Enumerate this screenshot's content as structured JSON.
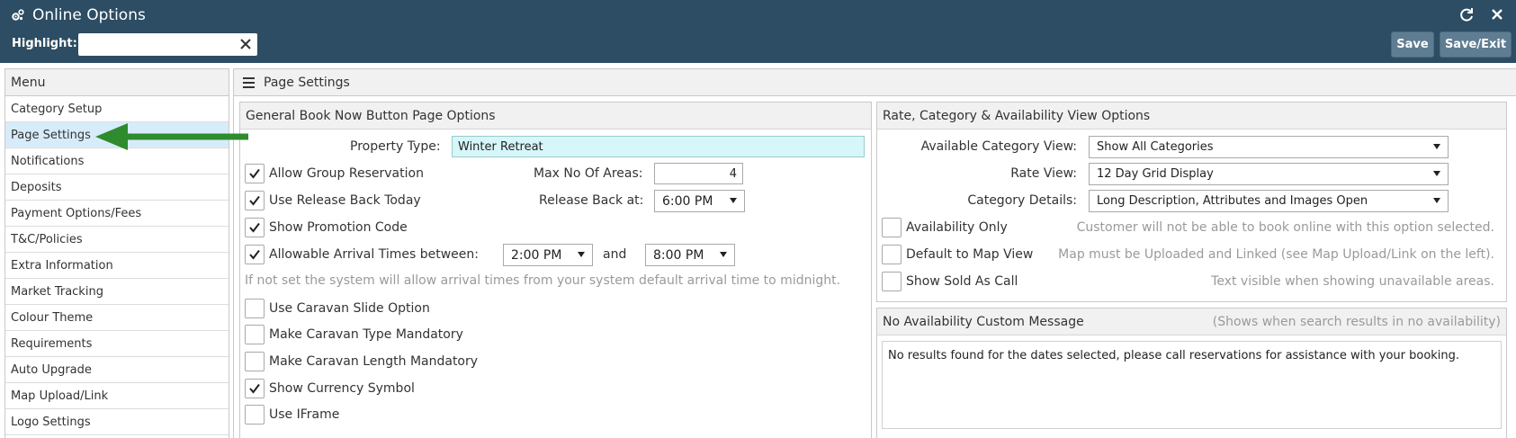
{
  "header": {
    "title": "Online Options",
    "icon": "gears-icon",
    "highlight_label": "Highlight:",
    "highlight_value": "",
    "save_label": "Save",
    "save_exit_label": "Save/Exit"
  },
  "sidebar": {
    "heading": "Menu",
    "items": [
      {
        "label": "Category Setup"
      },
      {
        "label": "Page Settings",
        "active": true
      },
      {
        "label": "Notifications"
      },
      {
        "label": "Deposits"
      },
      {
        "label": "Payment Options/Fees"
      },
      {
        "label": "T&C/Policies"
      },
      {
        "label": "Extra Information"
      },
      {
        "label": "Market Tracking"
      },
      {
        "label": "Colour Theme"
      },
      {
        "label": "Requirements"
      },
      {
        "label": "Auto Upgrade"
      },
      {
        "label": "Map Upload/Link"
      },
      {
        "label": "Logo Settings"
      }
    ]
  },
  "main": {
    "heading": "Page Settings"
  },
  "general": {
    "heading": "General Book Now Button Page Options",
    "property_type_label": "Property Type:",
    "property_type_value": "Winter Retreat",
    "allow_group": {
      "label": "Allow Group Reservation",
      "checked": true
    },
    "max_areas_label": "Max No Of Areas:",
    "max_areas_value": "4",
    "release_today": {
      "label": "Use Release Back Today",
      "checked": true
    },
    "release_back_label": "Release Back at:",
    "release_back_value": "6:00 PM",
    "promo_code": {
      "label": "Show Promotion Code",
      "checked": true
    },
    "arrival_times": {
      "label": "Allowable Arrival Times between:",
      "checked": true
    },
    "arrival_from": "2:00 PM",
    "and_label": "and",
    "arrival_to": "8:00 PM",
    "arrival_hint": "If not set the system will allow arrival times from your system default arrival time to midnight.",
    "caravan_slide": {
      "label": "Use Caravan Slide Option",
      "checked": false
    },
    "caravan_type": {
      "label": "Make Caravan Type Mandatory",
      "checked": false
    },
    "caravan_length": {
      "label": "Make Caravan Length Mandatory",
      "checked": false
    },
    "currency_symbol": {
      "label": "Show Currency Symbol",
      "checked": true
    },
    "iframe": {
      "label": "Use IFrame",
      "checked": false
    }
  },
  "rate": {
    "heading": "Rate, Category & Availability View Options",
    "category_view_label": "Available Category View:",
    "category_view_value": "Show All Categories",
    "rate_view_label": "Rate View:",
    "rate_view_value": "12 Day Grid Display",
    "category_details_label": "Category Details:",
    "category_details_value": "Long Description, Attributes and Images Open",
    "availability_only": {
      "label": "Availability Only",
      "checked": false,
      "hint": "Customer will not be able to book online with this option selected."
    },
    "map_view": {
      "label": "Default to Map View",
      "checked": false,
      "hint": "Map must be Uploaded and Linked (see Map Upload/Link on the left)."
    },
    "sold_as_call": {
      "label": "Show Sold As Call",
      "checked": false,
      "hint": "Text visible when showing unavailable areas."
    }
  },
  "no_avail": {
    "heading": "No Availability Custom Message",
    "subheading": "(Shows when search results in no availability)",
    "message": "No results found for the dates selected, please call reservations for assistance with your booking."
  },
  "colors": {
    "header_bg": "#2c4d63",
    "button_bg": "#5e7d92",
    "active_menu_bg": "#d7ecfa",
    "arrow_green": "#2e8b2e",
    "teal_field": "#d6f6f9"
  }
}
